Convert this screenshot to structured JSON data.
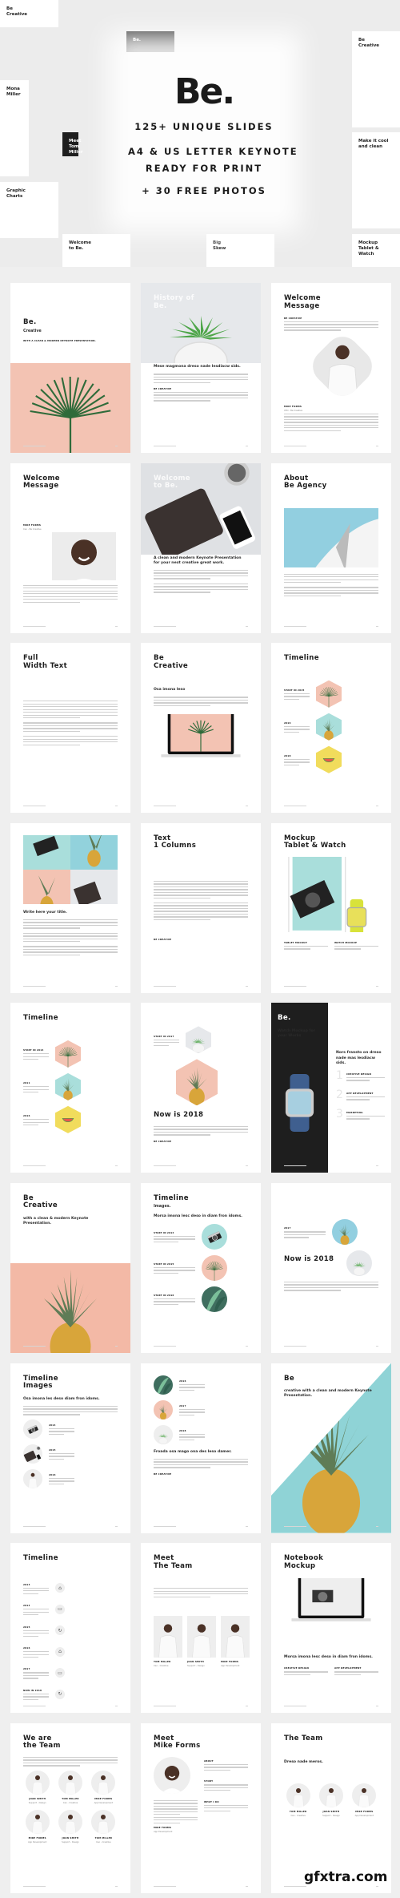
{
  "hero": {
    "logo": "Be.",
    "lines": [
      "125+ UNIQUE SLIDES",
      "A4 & US LETTER KEYNOTE",
      "READY FOR PRINT",
      "+ 30 FREE PHOTOS"
    ],
    "tiles": [
      {
        "title": "Be\nCreative",
        "dark": false
      },
      {
        "title": "Be.",
        "dark": true
      },
      {
        "title": "Be\nCreative",
        "dark": false
      },
      {
        "title": "Mona\nMiller",
        "dark": false
      },
      {
        "title": "Make it cool\nand clean",
        "dark": false
      },
      {
        "title": "Graphic\nCharts",
        "dark": false
      },
      {
        "title": "Meet\nTom Miller",
        "dark": true
      },
      {
        "title": "Big\nSkew",
        "dark": false
      },
      {
        "title": "Mockup\nTablet & Watch",
        "dark": false
      },
      {
        "title": "Welcome\nto Be.",
        "dark": false
      }
    ]
  },
  "colors": {
    "pink": "#f3c3b3",
    "teal": "#a9dedb",
    "sky": "#92cfe0",
    "yellow": "#f1dc5c",
    "gray": "#e6e8eb",
    "dark": "#1e1e1e",
    "background": "#efefef"
  },
  "pages": [
    {
      "blocks": [
        {
          "type": "gap",
          "size": "big"
        },
        {
          "type": "title",
          "lines": [
            "Be."
          ]
        },
        {
          "type": "sub",
          "text": "Creative"
        },
        {
          "type": "label",
          "text": "with a clean & modern Keynote Presentation."
        },
        {
          "type": "image",
          "variant": "bleed-bottom",
          "bg": "#f3c3b3",
          "subject": "palm"
        }
      ]
    },
    {
      "blocks": [
        {
          "type": "image",
          "variant": "bleed-top",
          "bg": "#e6e8eb",
          "subject": "succulent"
        },
        {
          "type": "title",
          "lines": [
            "History of",
            "Be."
          ],
          "color": "white"
        },
        {
          "type": "gap",
          "size": "big"
        },
        {
          "type": "gap",
          "size": "big"
        },
        {
          "type": "lead",
          "text": "Mese magmona dreso nade lesdiacw sids."
        },
        {
          "type": "para"
        },
        {
          "type": "label",
          "text": "BE CREATIVE"
        },
        {
          "type": "para"
        }
      ]
    },
    {
      "blocks": [
        {
          "type": "title",
          "lines": [
            "Welcome",
            "Message"
          ]
        },
        {
          "type": "label",
          "text": "BE CREATIVE"
        },
        {
          "type": "para"
        },
        {
          "type": "image",
          "variant": "diamond",
          "bg": "#e8e8e8",
          "subject": "person"
        },
        {
          "type": "label",
          "text": "MIKE FORMS"
        },
        {
          "type": "role",
          "text": "CEO - Be Creative"
        },
        {
          "type": "para",
          "size": "long"
        }
      ]
    },
    {
      "blocks": [
        {
          "type": "title",
          "lines": [
            "Welcome",
            "Message"
          ]
        },
        {
          "type": "gap",
          "size": "big"
        },
        {
          "type": "label",
          "text": "MIKE FORMS"
        },
        {
          "type": "role",
          "text": "Ceo - Be Creative"
        },
        {
          "type": "image",
          "variant": "inset-sm",
          "bg": "#ececec",
          "subject": "face"
        },
        {
          "type": "para",
          "size": "long"
        }
      ]
    },
    {
      "blocks": [
        {
          "type": "image",
          "variant": "bleed-top-lg",
          "bg": "#dfe1e4",
          "subject": "tablet"
        },
        {
          "type": "title",
          "lines": [
            "Welcome",
            "to Be."
          ],
          "color": "white"
        },
        {
          "type": "gap",
          "size": "big"
        },
        {
          "type": "gap",
          "size": "big"
        },
        {
          "type": "gap"
        },
        {
          "type": "lead",
          "text": "A clean and modern Keynote Presentation for your next creative great work."
        },
        {
          "type": "para"
        },
        {
          "type": "para"
        }
      ]
    },
    {
      "blocks": [
        {
          "type": "title",
          "lines": [
            "About",
            "Be Agency"
          ]
        },
        {
          "type": "gap"
        },
        {
          "type": "image",
          "variant": "inset",
          "bg": "#92cfe0",
          "subject": "building"
        },
        {
          "type": "para"
        },
        {
          "type": "para"
        }
      ]
    },
    {
      "blocks": [
        {
          "type": "title",
          "lines": [
            "Full",
            "Width Text"
          ]
        },
        {
          "type": "gap",
          "size": "big"
        },
        {
          "type": "para",
          "size": "long"
        },
        {
          "type": "para"
        },
        {
          "type": "para"
        }
      ]
    },
    {
      "blocks": [
        {
          "type": "title",
          "lines": [
            "Be",
            "Creative"
          ]
        },
        {
          "type": "gap"
        },
        {
          "type": "lead",
          "text": "Osa imona leso"
        },
        {
          "type": "para"
        },
        {
          "type": "image",
          "variant": "laptop",
          "bg": "#ffffff",
          "subject": "laptop"
        }
      ]
    },
    {
      "blocks": [
        {
          "type": "title",
          "lines": [
            "Timeline"
          ]
        },
        {
          "type": "gap"
        },
        {
          "type": "timeline",
          "entries": [
            {
              "label": "START IN 2015",
              "shape": "hex",
              "bg": "#f3c3b3",
              "subject": "palm"
            },
            {
              "label": "2016",
              "shape": "hex",
              "bg": "#a9dedb",
              "subject": "pineapple"
            },
            {
              "label": "2018",
              "shape": "hex",
              "bg": "#f1dc5c",
              "subject": "watermelon"
            }
          ]
        }
      ]
    },
    {
      "blocks": [
        {
          "type": "image",
          "variant": "grid",
          "bg": "#ffffff",
          "subject": "grid"
        },
        {
          "type": "lead",
          "text": "Write here your title."
        },
        {
          "type": "para"
        },
        {
          "type": "para"
        },
        {
          "type": "para"
        }
      ]
    },
    {
      "blocks": [
        {
          "type": "title",
          "lines": [
            "Text",
            "1 Columns"
          ]
        },
        {
          "type": "gap",
          "size": "big"
        },
        {
          "type": "para",
          "size": "long"
        },
        {
          "type": "para",
          "size": "long"
        },
        {
          "type": "gap"
        },
        {
          "type": "label",
          "text": "BE CREATIVE"
        }
      ]
    },
    {
      "blocks": [
        {
          "type": "title",
          "lines": [
            "Mockup",
            "Tablet & Watch"
          ]
        },
        {
          "type": "image",
          "variant": "tabwatch",
          "bg": "#ffffff",
          "subject": "tabwatch"
        },
        {
          "type": "cols",
          "items": [
            {
              "label": "TABLET MOCKUP"
            },
            {
              "label": "WATCH MOCKUP"
            }
          ]
        }
      ]
    },
    {
      "blocks": [
        {
          "type": "title",
          "lines": [
            "Timeline"
          ]
        },
        {
          "type": "gap"
        },
        {
          "type": "timeline",
          "entries": [
            {
              "label": "START IN 2014",
              "shape": "hex",
              "bg": "#f3c3b3",
              "subject": "palm"
            },
            {
              "label": "2011",
              "shape": "hex",
              "bg": "#a9dedb",
              "subject": "pineapple"
            },
            {
              "label": "2016",
              "shape": "hex",
              "bg": "#f1dc5c",
              "subject": "watermelon"
            }
          ]
        }
      ]
    },
    {
      "blocks": [
        {
          "type": "gap"
        },
        {
          "type": "timeline",
          "entries": [
            {
              "label": "START IN 2017",
              "shape": "hex",
              "bg": "#e6e8eb",
              "subject": "succulent"
            }
          ]
        },
        {
          "type": "hexbig",
          "bg": "#f3c3b3",
          "subject": "pineapple"
        },
        {
          "type": "title",
          "lines": [
            "Now is 2018"
          ]
        },
        {
          "type": "para"
        },
        {
          "type": "label",
          "text": "Be Creative"
        }
      ]
    },
    {
      "variant": "dark-split",
      "blocks": [
        {
          "type": "title",
          "col": "left",
          "lines": [
            "Be."
          ]
        },
        {
          "type": "lead",
          "col": "left",
          "text": "Watch Mockup for your Works"
        },
        {
          "type": "image",
          "col": "left",
          "variant": "watch",
          "bg": "#1e1e1e",
          "subject": "watch"
        },
        {
          "type": "lead",
          "col": "right",
          "text": "Nors fransto on dreso nade mas lesdiacw sids."
        },
        {
          "type": "numbered",
          "col": "right",
          "items": [
            {
              "n": "1",
              "label": "CREATIVE DESIGN"
            },
            {
              "n": "2",
              "label": "APP DEVELOPMENT"
            },
            {
              "n": "3",
              "label": "MARKETING"
            }
          ]
        }
      ]
    },
    {
      "blocks": [
        {
          "type": "title",
          "lines": [
            "Be",
            "Creative"
          ]
        },
        {
          "type": "lead",
          "text": "with a clean & modern Keynote Presentation."
        },
        {
          "type": "image",
          "variant": "bleed-bottom",
          "bg": "#f3b9a6",
          "subject": "pineapple"
        }
      ]
    },
    {
      "blocks": [
        {
          "type": "title",
          "lines": [
            "Timeline"
          ]
        },
        {
          "type": "sub",
          "text": "Images."
        },
        {
          "type": "lead",
          "text": "Morsa imona lesc deso in diam fron idoms."
        },
        {
          "type": "timeline",
          "wide": true,
          "entries": [
            {
              "label": "START IN 2014",
              "shape": "circle",
              "bg": "#a9dedb",
              "subject": "camera"
            },
            {
              "label": "START IN 2015",
              "shape": "circle",
              "bg": "#f3c3b3",
              "subject": "palm"
            },
            {
              "label": "START IN 2016",
              "shape": "circle",
              "bg": "#3f6e5f",
              "subject": "leaves"
            }
          ]
        }
      ]
    },
    {
      "blocks": [
        {
          "type": "gap",
          "size": "big"
        },
        {
          "type": "timeline",
          "wide": true,
          "entries": [
            {
              "label": "2017",
              "shape": "circle",
              "bg": "#92cfe0",
              "subject": "pineapple"
            }
          ]
        },
        {
          "type": "timeline",
          "entries": [
            {
              "label": "Now is 2018",
              "shape": "circle",
              "bg": "#e6e8eb",
              "subject": "succulent",
              "big": true
            }
          ]
        },
        {
          "type": "para"
        }
      ]
    },
    {
      "blocks": [
        {
          "type": "title",
          "lines": [
            "Timeline",
            "Images"
          ]
        },
        {
          "type": "lead",
          "text": "Osa imona les deso diam fron idoms."
        },
        {
          "type": "para"
        },
        {
          "type": "timeline",
          "reverse": true,
          "entries": [
            {
              "label": "2014",
              "shape": "circle-sm",
              "bg": "#eeeeee",
              "subject": "camera"
            },
            {
              "label": "2015",
              "shape": "circle-sm",
              "bg": "#eeeeee",
              "subject": "tablet"
            },
            {
              "label": "2016",
              "shape": "circle-sm",
              "bg": "#eeeeee",
              "subject": "person"
            }
          ]
        }
      ]
    },
    {
      "blocks": [
        {
          "type": "timeline",
          "reverse": true,
          "entries": [
            {
              "label": "2016",
              "shape": "circle-sm",
              "bg": "#3f6e5f",
              "subject": "leaves"
            },
            {
              "label": "2017",
              "shape": "circle-sm",
              "bg": "#f3c3b3",
              "subject": "pineapple"
            },
            {
              "label": "2018",
              "shape": "circle-sm",
              "bg": "#eeeeee",
              "subject": "succulent"
            }
          ]
        },
        {
          "type": "lead",
          "text": "Froada osa mago ona des leso damer."
        },
        {
          "type": "para"
        },
        {
          "type": "label",
          "text": "Be Creative"
        }
      ]
    },
    {
      "blocks": [
        {
          "type": "image",
          "variant": "diag",
          "bg": "#8fd3d6",
          "subject": "pineapple"
        },
        {
          "type": "title",
          "lines": [
            "Be"
          ]
        },
        {
          "type": "lead",
          "text": "creative with a clean and modern Keynote Presentation."
        }
      ]
    },
    {
      "blocks": [
        {
          "type": "title",
          "lines": [
            "Timeline"
          ]
        },
        {
          "type": "gap"
        },
        {
          "type": "timeline",
          "icons": true,
          "entries": [
            {
              "label": "2013",
              "shape": "icon",
              "icon": "home-icon"
            },
            {
              "label": "2014",
              "shape": "icon",
              "icon": "folder-icon"
            },
            {
              "label": "2015",
              "shape": "icon",
              "icon": "refresh-icon"
            },
            {
              "label": "2016",
              "shape": "icon",
              "icon": "home-icon"
            },
            {
              "label": "2017",
              "shape": "icon",
              "icon": "folder-icon"
            },
            {
              "label": "NOW IN 2018",
              "shape": "icon",
              "icon": "refresh-icon"
            }
          ]
        }
      ]
    },
    {
      "blocks": [
        {
          "type": "title",
          "lines": [
            "Meet",
            "The Team"
          ]
        },
        {
          "type": "gap"
        },
        {
          "type": "para"
        },
        {
          "type": "gap"
        },
        {
          "type": "people",
          "style": "rect",
          "members": [
            {
              "name": "TOM MILLER",
              "role": "Ceo - Creative"
            },
            {
              "name": "JOAN SMITH",
              "role": "Support - Design"
            },
            {
              "name": "MIKE FORMS",
              "role": "App Development"
            }
          ]
        }
      ]
    },
    {
      "blocks": [
        {
          "type": "title",
          "lines": [
            "Notebook",
            "Mockup"
          ]
        },
        {
          "type": "image",
          "variant": "laptop",
          "bg": "#ffffff",
          "subject": "notebook"
        },
        {
          "type": "gap"
        },
        {
          "type": "lead",
          "text": "Morsa imona lesc deso in diam fron idoms."
        },
        {
          "type": "cols",
          "items": [
            {
              "label": "CREATIVE DESIGN"
            },
            {
              "label": "APP DEVELOPMENT"
            }
          ]
        }
      ]
    },
    {
      "blocks": [
        {
          "type": "title",
          "lines": [
            "We are",
            "the Team"
          ]
        },
        {
          "type": "para"
        },
        {
          "type": "people",
          "style": "circle",
          "members": [
            {
              "name": "JOAN SMITH",
              "role": "Support - Design"
            },
            {
              "name": "TOM MILLER",
              "role": "Ceo - Creative"
            },
            {
              "name": "MIKE FORMS",
              "role": "App Development"
            },
            {
              "name": "MIKE FORMS",
              "role": "App Development"
            },
            {
              "name": "JOAN SMITH",
              "role": "Support - Design"
            },
            {
              "name": "TOM MILLER",
              "role": "Ceo - Creative"
            }
          ]
        }
      ]
    },
    {
      "blocks": [
        {
          "type": "title",
          "lines": [
            "Meet",
            "Mike Forms"
          ]
        },
        {
          "type": "profile",
          "sections": [
            {
              "label": "ABOUT"
            },
            {
              "label": "STORY"
            },
            {
              "label": "WHAT I DO"
            }
          ],
          "name": "MIKE FORMS",
          "role": "App Development"
        }
      ]
    },
    {
      "blocks": [
        {
          "type": "title",
          "lines": [
            "The Team"
          ]
        },
        {
          "type": "gap"
        },
        {
          "type": "lead",
          "text": "Dreso nade meros."
        },
        {
          "type": "gap"
        },
        {
          "type": "people",
          "style": "circle",
          "members": [
            {
              "name": "TOM MILLER",
              "role": "Ceo - Creative"
            },
            {
              "name": "JOAN SMITH",
              "role": "Support - Design"
            },
            {
              "name": "MIKE FORMS",
              "role": "App Development"
            }
          ]
        }
      ]
    }
  ],
  "watermark": "gfxtra.com"
}
